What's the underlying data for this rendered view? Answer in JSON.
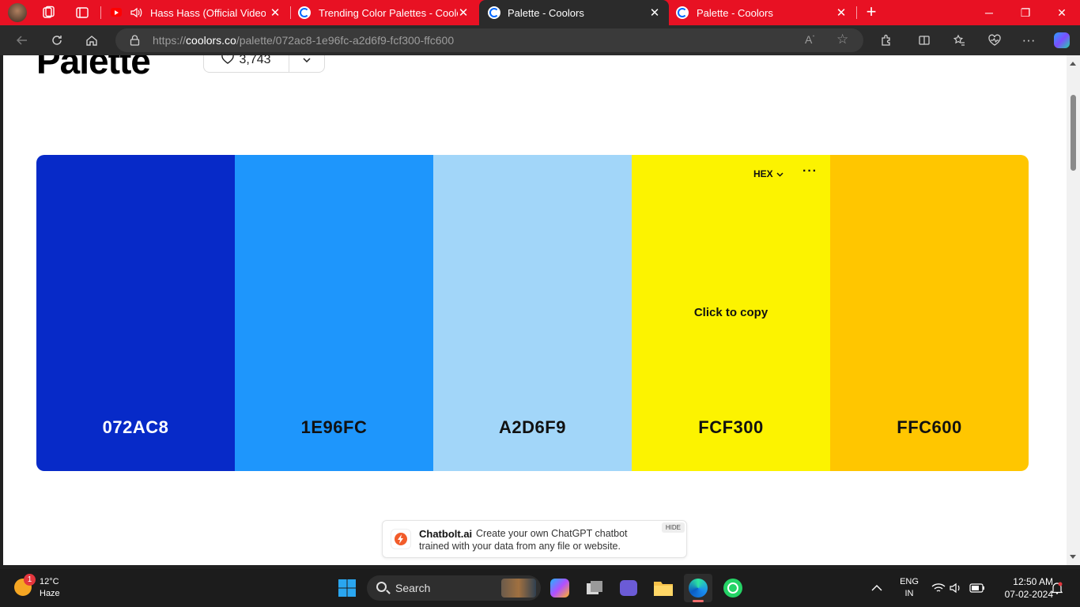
{
  "browser": {
    "tabs": [
      {
        "title": "Hass Hass (Official Video) D",
        "audio": true,
        "active": false
      },
      {
        "title": "Trending Color Palettes - Coolors",
        "active": false
      },
      {
        "title": "Palette - Coolors",
        "active": true
      },
      {
        "title": "Palette - Coolors",
        "active": false
      }
    ],
    "url_prefix": "https://",
    "url_domain": "coolors.co",
    "url_path": "/palette/072ac8-1e96fc-a2d6f9-fcf300-ffc600"
  },
  "page": {
    "heading": "Palette",
    "likes": "3,743",
    "palette": [
      {
        "hex": "072AC8",
        "color": "#072ac8",
        "text_color": "#ffffff"
      },
      {
        "hex": "1E96FC",
        "color": "#1e96fc",
        "text_color": "#111111"
      },
      {
        "hex": "A2D6F9",
        "color": "#a2d6f9",
        "text_color": "#111111"
      },
      {
        "hex": "FCF300",
        "color": "#fcf300",
        "text_color": "#111111",
        "hovered": true,
        "click_to_copy": "Click to copy",
        "format": "HEX"
      },
      {
        "hex": "FFC600",
        "color": "#ffc600",
        "text_color": "#111111"
      }
    ],
    "ad": {
      "brand": "Chatbolt.ai",
      "line1": "Create your own ChatGPT chatbot",
      "line2": "trained with your data from any file or website.",
      "hide": "HIDE"
    }
  },
  "taskbar": {
    "weather_badge": "1",
    "temperature": "12°C",
    "condition": "Haze",
    "search_label": "Search",
    "language": "ENG",
    "region": "IN",
    "time": "12:50 AM",
    "date": "07-02-2024"
  },
  "colors": {
    "tabstrip": "#e81123",
    "toolbar": "#2b2b2b",
    "accent_blue": "#0078d4"
  }
}
